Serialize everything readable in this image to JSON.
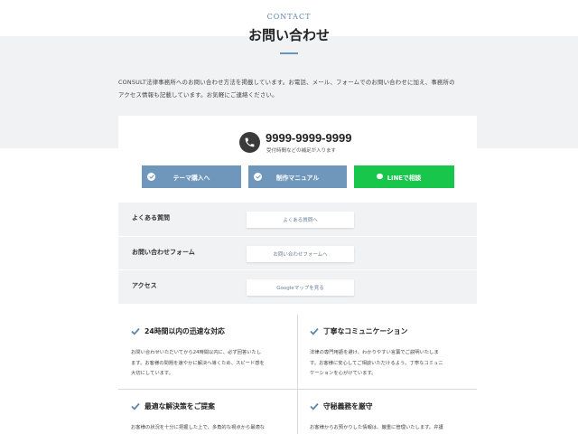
{
  "header": {
    "eyebrow": "CONTACT",
    "title": "お問い合わせ"
  },
  "intro": {
    "lines": [
      "CONSULT法律事務所へのお問い合わせ方法を掲載しています。お電話、メール、フォームでのお問い合わせに加え、事務所の",
      "アクセス情報も記載しています。お気軽にご連絡ください。"
    ]
  },
  "phone": {
    "icon": "phone-icon",
    "number": "9999-9999-9999",
    "note": "受付時間などの補足が入ります"
  },
  "buttons": [
    {
      "label": "テーマ購入へ",
      "icon": "check-circle-icon",
      "color": "#6f97bc"
    },
    {
      "label": "制作マニュアル",
      "icon": "check-circle-icon",
      "color": "#6f97bc"
    },
    {
      "label": "LINEで相談",
      "icon": "line-icon",
      "color": "#19c64c"
    }
  ],
  "rows": [
    {
      "label": "よくある質問",
      "button": "よくある質問へ"
    },
    {
      "label": "お問い合わせフォーム",
      "button": "お問い合わせフォームへ"
    },
    {
      "label": "アクセス",
      "button": "Googleマップを見る"
    }
  ],
  "features": [
    {
      "title": "24時間以内の迅速な対応",
      "lines": [
        "お問い合わせいただいてから24時間以内に、必ず回答いたし",
        "ます。お客様の問題を速やかに解決へ導くため、スピード感を",
        "大切にしています。"
      ]
    },
    {
      "title": "丁寧なコミュニケーション",
      "lines": [
        "法律の専門用語を避け、わかりやすい言葉でご説明いたしま",
        "す。お客様に安心してご相談いただけるよう、丁寧なコミュニ",
        "ケーションを心がけています。"
      ]
    },
    {
      "title": "最適な解決策をご提案",
      "lines": [
        "お客様の状況を十分に把握した上で、多角的な視点から最適な"
      ]
    },
    {
      "title": "守秘義務を厳守",
      "lines": [
        "お客様からお預かりした情報は、厳重に管理いたします。弁護"
      ]
    }
  ],
  "colors": {
    "accent": "#6f97bc",
    "line_green": "#19c64c",
    "band": "#f0f2f4"
  }
}
